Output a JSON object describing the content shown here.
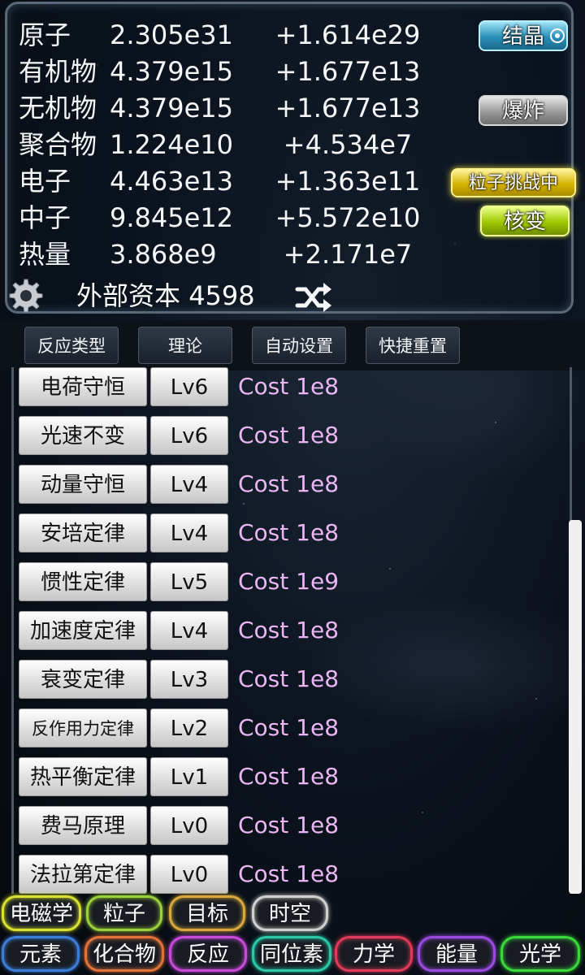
{
  "resources": [
    {
      "name": "原子",
      "value": "2.305e31",
      "rate": "+1.614e29"
    },
    {
      "name": "有机物",
      "value": "4.379e15",
      "rate": "+1.677e13"
    },
    {
      "name": "无机物",
      "value": "4.379e15",
      "rate": "+1.677e13"
    },
    {
      "name": "聚合物",
      "value": "1.224e10",
      "rate": "+4.534e7"
    },
    {
      "name": "电子",
      "value": "4.463e13",
      "rate": "+1.363e11"
    },
    {
      "name": "中子",
      "value": "9.845e12",
      "rate": "+5.572e10"
    },
    {
      "name": "热量",
      "value": "3.868e9",
      "rate": "+2.171e7"
    }
  ],
  "side_buttons": {
    "crystal": "结晶",
    "explode": "爆炸",
    "particle_challenge": "粒子挑战中",
    "fission": "核变"
  },
  "capital": {
    "label": "外部资本",
    "value": "4598"
  },
  "tabs": [
    "反应类型",
    "理论",
    "自动设置",
    "快捷重置"
  ],
  "laws": [
    {
      "name": "电荷守恒",
      "level": "Lv6",
      "cost": "Cost 1e8"
    },
    {
      "name": "光速不变",
      "level": "Lv6",
      "cost": "Cost 1e8"
    },
    {
      "name": "动量守恒",
      "level": "Lv4",
      "cost": "Cost 1e8"
    },
    {
      "name": "安培定律",
      "level": "Lv4",
      "cost": "Cost 1e8"
    },
    {
      "name": "惯性定律",
      "level": "Lv5",
      "cost": "Cost 1e9"
    },
    {
      "name": "加速度定律",
      "level": "Lv4",
      "cost": "Cost 1e8"
    },
    {
      "name": "衰变定律",
      "level": "Lv3",
      "cost": "Cost 1e8"
    },
    {
      "name": "反作用力定律",
      "level": "Lv2",
      "cost": "Cost 1e8"
    },
    {
      "name": "热平衡定律",
      "level": "Lv1",
      "cost": "Cost 1e8"
    },
    {
      "name": "费马原理",
      "level": "Lv0",
      "cost": "Cost 1e8"
    },
    {
      "name": "法拉第定律",
      "level": "Lv0",
      "cost": "Cost 1e8"
    }
  ],
  "nav_row1": [
    {
      "label": "电磁学",
      "color": "#d8e030"
    },
    {
      "label": "粒子",
      "color": "#9ad03a"
    },
    {
      "label": "目标",
      "color": "#d8a83a"
    },
    {
      "label": "时空",
      "color": "#d0d0d0"
    }
  ],
  "nav_row2": [
    {
      "label": "元素",
      "color": "#3a7ed8"
    },
    {
      "label": "化合物",
      "color": "#e0723a"
    },
    {
      "label": "反应",
      "color": "#c84ad8"
    },
    {
      "label": "同位素",
      "color": "#2ac8a8"
    },
    {
      "label": "力学",
      "color": "#e03a5a"
    },
    {
      "label": "能量",
      "color": "#9a4ae0"
    },
    {
      "label": "光学",
      "color": "#3ad83a"
    }
  ]
}
